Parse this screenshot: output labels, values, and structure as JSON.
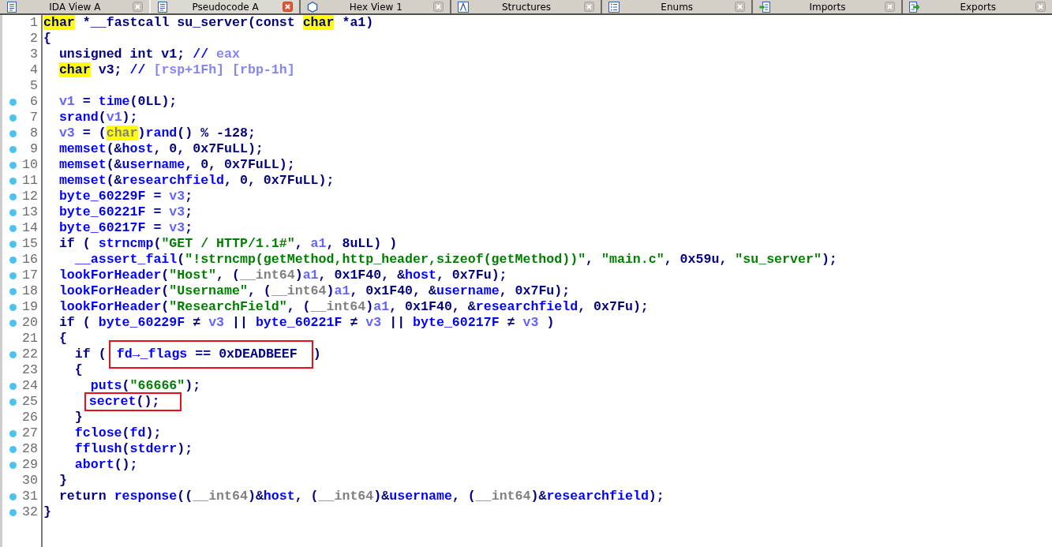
{
  "tabs": [
    {
      "label": "IDA View A",
      "selected": false
    },
    {
      "label": "Pseudocode A",
      "selected": true
    },
    {
      "label": "Hex View 1",
      "selected": false
    },
    {
      "label": "Structures",
      "selected": false
    },
    {
      "label": "Enums",
      "selected": false
    },
    {
      "label": "Imports",
      "selected": false
    },
    {
      "label": "Exports",
      "selected": false
    }
  ],
  "code": {
    "lines": [
      {
        "number": "1",
        "dot": false,
        "tokens": [
          {
            "kind": "marked",
            "text": "char"
          },
          {
            "kind": "plain",
            "text": " *__fastcall su_server(const "
          },
          {
            "kind": "marked",
            "text": "char"
          },
          {
            "kind": "plain",
            "text": " *a1)"
          }
        ]
      },
      {
        "number": "2",
        "dot": false,
        "tokens": [
          {
            "kind": "plain",
            "text": "{"
          }
        ],
        "children": [
          {
            "number": "3",
            "dot": false,
            "tokens": [
              {
                "kind": "plain",
                "text": "unsigned int v1; "
              },
              {
                "kind": "name",
                "text": "//"
              },
              {
                "kind": "comment",
                "text": " eax"
              }
            ]
          },
          {
            "number": "4",
            "dot": false,
            "tokens": [
              {
                "kind": "marked",
                "text": "char"
              },
              {
                "kind": "plain",
                "text": " v3; "
              },
              {
                "kind": "name",
                "text": "//"
              },
              {
                "kind": "comment",
                "text": " [rsp+1Fh] [rbp-1h]"
              }
            ]
          },
          {
            "number": "5",
            "dot": false
          },
          {
            "number": "6",
            "dot": true,
            "tokens": [
              {
                "kind": "local",
                "text": "v1"
              },
              {
                "kind": "plain",
                "text": " = "
              },
              {
                "kind": "name",
                "text": "time"
              },
              {
                "kind": "plain",
                "text": "(0LL);"
              }
            ]
          },
          {
            "number": "7",
            "dot": true,
            "tokens": [
              {
                "kind": "name",
                "text": "srand"
              },
              {
                "kind": "plain",
                "text": "("
              },
              {
                "kind": "local",
                "text": "v1"
              },
              {
                "kind": "plain",
                "text": ");"
              }
            ]
          },
          {
            "number": "8",
            "dot": true,
            "tokens": [
              {
                "kind": "local",
                "text": "v3"
              },
              {
                "kind": "plain",
                "text": " = ("
              },
              {
                "kind": "marked-cast",
                "text": "char"
              },
              {
                "kind": "plain",
                "text": ")"
              },
              {
                "kind": "name",
                "text": "rand"
              },
              {
                "kind": "plain",
                "text": "() % -128;"
              }
            ]
          },
          {
            "number": "9",
            "dot": true,
            "tokens": [
              {
                "kind": "name",
                "text": "memset"
              },
              {
                "kind": "plain",
                "text": "(&"
              },
              {
                "kind": "name",
                "text": "host"
              },
              {
                "kind": "plain",
                "text": ", 0, 0x7FuLL);"
              }
            ]
          },
          {
            "number": "10",
            "dot": true,
            "tokens": [
              {
                "kind": "name",
                "text": "memset"
              },
              {
                "kind": "plain",
                "text": "(&"
              },
              {
                "kind": "name",
                "text": "username"
              },
              {
                "kind": "plain",
                "text": ", 0, 0x7FuLL);"
              }
            ]
          },
          {
            "number": "11",
            "dot": true,
            "tokens": [
              {
                "kind": "name",
                "text": "memset"
              },
              {
                "kind": "plain",
                "text": "(&"
              },
              {
                "kind": "name",
                "text": "researchfield"
              },
              {
                "kind": "plain",
                "text": ", 0, 0x7FuLL);"
              }
            ]
          },
          {
            "number": "12",
            "dot": true,
            "tokens": [
              {
                "kind": "name",
                "text": "byte_60229F"
              },
              {
                "kind": "plain",
                "text": " = "
              },
              {
                "kind": "local",
                "text": "v3"
              },
              {
                "kind": "plain",
                "text": ";"
              }
            ]
          },
          {
            "number": "13",
            "dot": true,
            "tokens": [
              {
                "kind": "name",
                "text": "byte_60221F"
              },
              {
                "kind": "plain",
                "text": " = "
              },
              {
                "kind": "local",
                "text": "v3"
              },
              {
                "kind": "plain",
                "text": ";"
              }
            ]
          },
          {
            "number": "14",
            "dot": true,
            "tokens": [
              {
                "kind": "name",
                "text": "byte_60217F"
              },
              {
                "kind": "plain",
                "text": " = "
              },
              {
                "kind": "local",
                "text": "v3"
              },
              {
                "kind": "plain",
                "text": ";"
              }
            ]
          },
          {
            "number": "15",
            "dot": true,
            "tokens": [
              {
                "kind": "plain",
                "text": "if ( "
              },
              {
                "kind": "name",
                "text": "strncmp"
              },
              {
                "kind": "plain",
                "text": "("
              },
              {
                "kind": "string",
                "text": "\"GET / HTTP/1.1#\""
              },
              {
                "kind": "plain",
                "text": ", "
              },
              {
                "kind": "local",
                "text": "a1"
              },
              {
                "kind": "plain",
                "text": ", 8uLL) )"
              }
            ],
            "children": [
              {
                "number": "16",
                "dot": true,
                "tokens": [
                  {
                    "kind": "name",
                    "text": "__assert_fail"
                  },
                  {
                    "kind": "plain",
                    "text": "("
                  },
                  {
                    "kind": "string",
                    "text": "\"!strncmp(getMethod,http_header,sizeof(getMethod))\""
                  },
                  {
                    "kind": "plain",
                    "text": ", "
                  },
                  {
                    "kind": "string",
                    "text": "\"main.c\""
                  },
                  {
                    "kind": "plain",
                    "text": ", 0x59u, "
                  },
                  {
                    "kind": "string",
                    "text": "\"su_server\""
                  },
                  {
                    "kind": "plain",
                    "text": ");"
                  }
                ]
              }
            ]
          },
          {
            "number": "17",
            "dot": true,
            "tokens": [
              {
                "kind": "name",
                "text": "lookForHeader"
              },
              {
                "kind": "plain",
                "text": "("
              },
              {
                "kind": "string",
                "text": "\"Host\""
              },
              {
                "kind": "plain",
                "text": ", ("
              },
              {
                "kind": "cast",
                "text": "__int64"
              },
              {
                "kind": "plain",
                "text": ")"
              },
              {
                "kind": "local",
                "text": "a1"
              },
              {
                "kind": "plain",
                "text": ", 0x1F40, &"
              },
              {
                "kind": "name",
                "text": "host"
              },
              {
                "kind": "plain",
                "text": ", 0x7Fu);"
              }
            ]
          },
          {
            "number": "18",
            "dot": true,
            "tokens": [
              {
                "kind": "name",
                "text": "lookForHeader"
              },
              {
                "kind": "plain",
                "text": "("
              },
              {
                "kind": "string",
                "text": "\"Username\""
              },
              {
                "kind": "plain",
                "text": ", ("
              },
              {
                "kind": "cast",
                "text": "__int64"
              },
              {
                "kind": "plain",
                "text": ")"
              },
              {
                "kind": "local",
                "text": "a1"
              },
              {
                "kind": "plain",
                "text": ", 0x1F40, &"
              },
              {
                "kind": "name",
                "text": "username"
              },
              {
                "kind": "plain",
                "text": ", 0x7Fu);"
              }
            ]
          },
          {
            "number": "19",
            "dot": true,
            "tokens": [
              {
                "kind": "name",
                "text": "lookForHeader"
              },
              {
                "kind": "plain",
                "text": "("
              },
              {
                "kind": "string",
                "text": "\"ResearchField\""
              },
              {
                "kind": "plain",
                "text": ", ("
              },
              {
                "kind": "cast",
                "text": "__int64"
              },
              {
                "kind": "plain",
                "text": ")"
              },
              {
                "kind": "local",
                "text": "a1"
              },
              {
                "kind": "plain",
                "text": ", 0x1F40, &"
              },
              {
                "kind": "name",
                "text": "researchfield"
              },
              {
                "kind": "plain",
                "text": ", 0x7Fu);"
              }
            ]
          },
          {
            "number": "20",
            "dot": true,
            "tokens": [
              {
                "kind": "plain",
                "text": "if ( "
              },
              {
                "kind": "name",
                "text": "byte_60229F"
              },
              {
                "kind": "plain",
                "text": " ≠ "
              },
              {
                "kind": "local",
                "text": "v3"
              },
              {
                "kind": "plain",
                "text": " || "
              },
              {
                "kind": "name",
                "text": "byte_60221F"
              },
              {
                "kind": "plain",
                "text": " ≠ "
              },
              {
                "kind": "local",
                "text": "v3"
              },
              {
                "kind": "plain",
                "text": " || "
              },
              {
                "kind": "name",
                "text": "byte_60217F"
              },
              {
                "kind": "plain",
                "text": " ≠ "
              },
              {
                "kind": "local",
                "text": "v3"
              },
              {
                "kind": "plain",
                "text": " )"
              }
            ]
          },
          {
            "number": "21",
            "dot": false,
            "tokens": [
              {
                "kind": "plain",
                "text": "{"
              }
            ],
            "children": [
              {
                "number": "22",
                "dot": true,
                "tokens": [
                  {
                    "kind": "plain",
                    "text": "if ("
                  },
                  {
                    "kind": "annotation-box",
                    "tokens": [
                      {
                        "kind": "name",
                        "text": "fd→_flags"
                      },
                      {
                        "kind": "plain",
                        "text": " == 0xDEADBEEF"
                      }
                    ]
                  },
                  {
                    "kind": "plain",
                    "text": ")"
                  }
                ]
              },
              {
                "number": "23",
                "dot": false,
                "tokens": [
                  {
                    "kind": "plain",
                    "text": "{"
                  }
                ],
                "children": [
                  {
                    "number": "24",
                    "dot": true,
                    "tokens": [
                      {
                        "kind": "name",
                        "text": "puts"
                      },
                      {
                        "kind": "plain",
                        "text": "("
                      },
                      {
                        "kind": "string",
                        "text": "\"66666\""
                      },
                      {
                        "kind": "plain",
                        "text": ");"
                      }
                    ]
                  },
                  {
                    "number": "25",
                    "dot": true,
                    "tokens": [
                      {
                        "kind": "annotation-box",
                        "tokens": [
                          {
                            "kind": "name",
                            "text": "secret"
                          },
                          {
                            "kind": "plain",
                            "text": "();"
                          }
                        ]
                      }
                    ]
                  }
                ]
              },
              {
                "number": "26",
                "dot": false,
                "tokens": [
                  {
                    "kind": "plain",
                    "text": "}"
                  }
                ]
              },
              {
                "number": "27",
                "dot": true,
                "tokens": [
                  {
                    "kind": "name",
                    "text": "fclose"
                  },
                  {
                    "kind": "plain",
                    "text": "("
                  },
                  {
                    "kind": "name",
                    "text": "fd"
                  },
                  {
                    "kind": "plain",
                    "text": ");"
                  }
                ]
              },
              {
                "number": "28",
                "dot": true,
                "tokens": [
                  {
                    "kind": "name",
                    "text": "fflush"
                  },
                  {
                    "kind": "plain",
                    "text": "("
                  },
                  {
                    "kind": "name",
                    "text": "stderr"
                  },
                  {
                    "kind": "plain",
                    "text": ");"
                  }
                ]
              },
              {
                "number": "29",
                "dot": true,
                "tokens": [
                  {
                    "kind": "name",
                    "text": "abort"
                  },
                  {
                    "kind": "plain",
                    "text": "();"
                  }
                ]
              }
            ]
          },
          {
            "number": "30",
            "dot": false,
            "tokens": [
              {
                "kind": "plain",
                "text": "}"
              }
            ]
          },
          {
            "number": "31",
            "dot": true,
            "tokens": [
              {
                "kind": "plain",
                "text": "return "
              },
              {
                "kind": "name",
                "text": "response"
              },
              {
                "kind": "plain",
                "text": "(("
              },
              {
                "kind": "cast",
                "text": "__int64"
              },
              {
                "kind": "plain",
                "text": ")&"
              },
              {
                "kind": "name",
                "text": "host"
              },
              {
                "kind": "plain",
                "text": ", ("
              },
              {
                "kind": "cast",
                "text": "__int64"
              },
              {
                "kind": "plain",
                "text": ")&"
              },
              {
                "kind": "name",
                "text": "username"
              },
              {
                "kind": "plain",
                "text": ", ("
              },
              {
                "kind": "cast",
                "text": "__int64"
              },
              {
                "kind": "plain",
                "text": ")&"
              },
              {
                "kind": "name",
                "text": "researchfield"
              },
              {
                "kind": "plain",
                "text": ");"
              }
            ]
          }
        ]
      },
      {
        "number": "32",
        "dot": true,
        "tokens": [
          {
            "kind": "plain",
            "text": "}"
          }
        ]
      }
    ]
  }
}
